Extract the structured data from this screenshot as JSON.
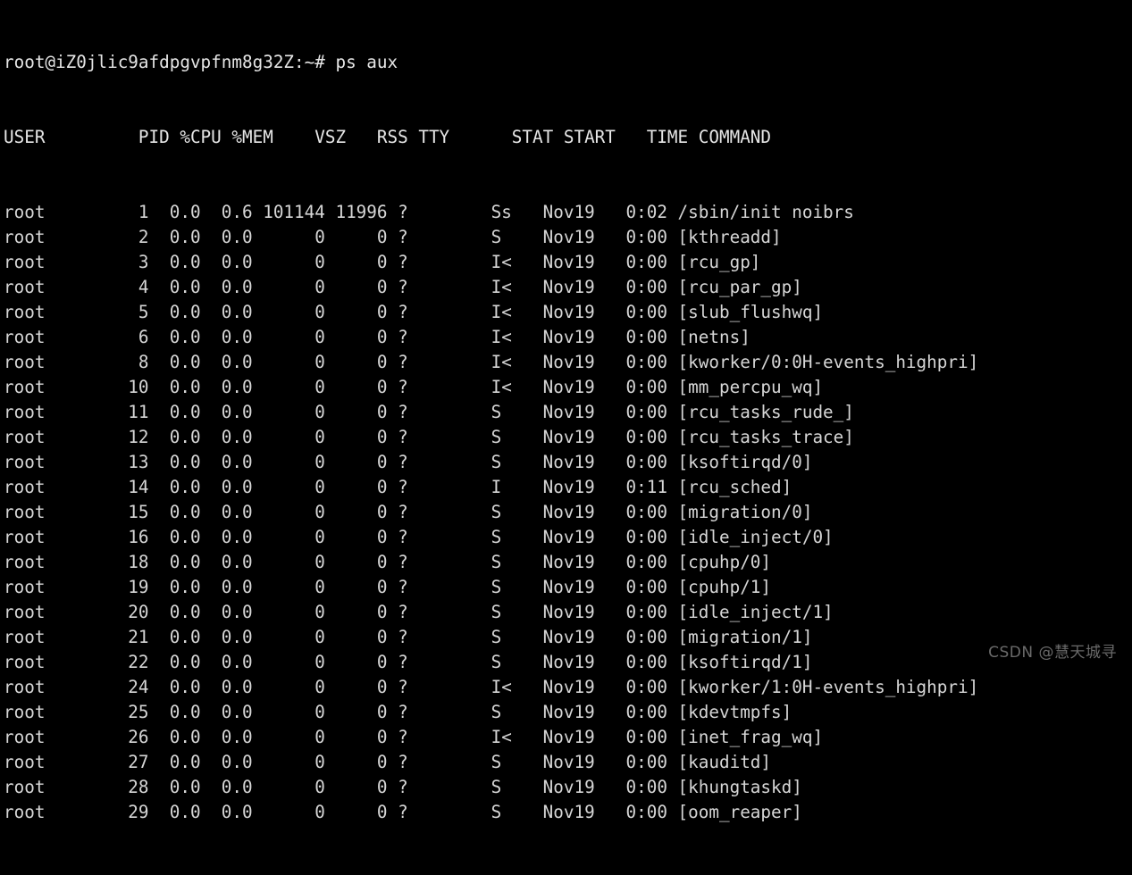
{
  "terminal": {
    "background_color": "#000000",
    "foreground_color": "#d8d8d8",
    "prompt_line": "root@iZ0jlic9afdpgvpfnm8g32Z:~# ps aux",
    "user": "root",
    "hostname": "iZ0jlic9afdpgvpfnm8g32Z",
    "cwd_symbol": "~",
    "prompt_symbol": "#",
    "command": "ps aux",
    "header": "USER         PID %CPU %MEM    VSZ   RSS TTY      STAT START   TIME COMMAND",
    "columns": [
      "USER",
      "PID",
      "%CPU",
      "%MEM",
      "VSZ",
      "RSS",
      "TTY",
      "STAT",
      "START",
      "TIME",
      "COMMAND"
    ],
    "rows": [
      {
        "USER": "root",
        "PID": "1",
        "CPU": "0.0",
        "MEM": "0.6",
        "VSZ": "101144",
        "RSS": "11996",
        "TTY": "?",
        "STAT": "Ss",
        "START": "Nov19",
        "TIME": "0:02",
        "COMMAND": "/sbin/init noibrs"
      },
      {
        "USER": "root",
        "PID": "2",
        "CPU": "0.0",
        "MEM": "0.0",
        "VSZ": "0",
        "RSS": "0",
        "TTY": "?",
        "STAT": "S",
        "START": "Nov19",
        "TIME": "0:00",
        "COMMAND": "[kthreadd]"
      },
      {
        "USER": "root",
        "PID": "3",
        "CPU": "0.0",
        "MEM": "0.0",
        "VSZ": "0",
        "RSS": "0",
        "TTY": "?",
        "STAT": "I<",
        "START": "Nov19",
        "TIME": "0:00",
        "COMMAND": "[rcu_gp]"
      },
      {
        "USER": "root",
        "PID": "4",
        "CPU": "0.0",
        "MEM": "0.0",
        "VSZ": "0",
        "RSS": "0",
        "TTY": "?",
        "STAT": "I<",
        "START": "Nov19",
        "TIME": "0:00",
        "COMMAND": "[rcu_par_gp]"
      },
      {
        "USER": "root",
        "PID": "5",
        "CPU": "0.0",
        "MEM": "0.0",
        "VSZ": "0",
        "RSS": "0",
        "TTY": "?",
        "STAT": "I<",
        "START": "Nov19",
        "TIME": "0:00",
        "COMMAND": "[slub_flushwq]"
      },
      {
        "USER": "root",
        "PID": "6",
        "CPU": "0.0",
        "MEM": "0.0",
        "VSZ": "0",
        "RSS": "0",
        "TTY": "?",
        "STAT": "I<",
        "START": "Nov19",
        "TIME": "0:00",
        "COMMAND": "[netns]"
      },
      {
        "USER": "root",
        "PID": "8",
        "CPU": "0.0",
        "MEM": "0.0",
        "VSZ": "0",
        "RSS": "0",
        "TTY": "?",
        "STAT": "I<",
        "START": "Nov19",
        "TIME": "0:00",
        "COMMAND": "[kworker/0:0H-events_highpri]"
      },
      {
        "USER": "root",
        "PID": "10",
        "CPU": "0.0",
        "MEM": "0.0",
        "VSZ": "0",
        "RSS": "0",
        "TTY": "?",
        "STAT": "I<",
        "START": "Nov19",
        "TIME": "0:00",
        "COMMAND": "[mm_percpu_wq]"
      },
      {
        "USER": "root",
        "PID": "11",
        "CPU": "0.0",
        "MEM": "0.0",
        "VSZ": "0",
        "RSS": "0",
        "TTY": "?",
        "STAT": "S",
        "START": "Nov19",
        "TIME": "0:00",
        "COMMAND": "[rcu_tasks_rude_]"
      },
      {
        "USER": "root",
        "PID": "12",
        "CPU": "0.0",
        "MEM": "0.0",
        "VSZ": "0",
        "RSS": "0",
        "TTY": "?",
        "STAT": "S",
        "START": "Nov19",
        "TIME": "0:00",
        "COMMAND": "[rcu_tasks_trace]"
      },
      {
        "USER": "root",
        "PID": "13",
        "CPU": "0.0",
        "MEM": "0.0",
        "VSZ": "0",
        "RSS": "0",
        "TTY": "?",
        "STAT": "S",
        "START": "Nov19",
        "TIME": "0:00",
        "COMMAND": "[ksoftirqd/0]"
      },
      {
        "USER": "root",
        "PID": "14",
        "CPU": "0.0",
        "MEM": "0.0",
        "VSZ": "0",
        "RSS": "0",
        "TTY": "?",
        "STAT": "I",
        "START": "Nov19",
        "TIME": "0:11",
        "COMMAND": "[rcu_sched]"
      },
      {
        "USER": "root",
        "PID": "15",
        "CPU": "0.0",
        "MEM": "0.0",
        "VSZ": "0",
        "RSS": "0",
        "TTY": "?",
        "STAT": "S",
        "START": "Nov19",
        "TIME": "0:00",
        "COMMAND": "[migration/0]"
      },
      {
        "USER": "root",
        "PID": "16",
        "CPU": "0.0",
        "MEM": "0.0",
        "VSZ": "0",
        "RSS": "0",
        "TTY": "?",
        "STAT": "S",
        "START": "Nov19",
        "TIME": "0:00",
        "COMMAND": "[idle_inject/0]"
      },
      {
        "USER": "root",
        "PID": "18",
        "CPU": "0.0",
        "MEM": "0.0",
        "VSZ": "0",
        "RSS": "0",
        "TTY": "?",
        "STAT": "S",
        "START": "Nov19",
        "TIME": "0:00",
        "COMMAND": "[cpuhp/0]"
      },
      {
        "USER": "root",
        "PID": "19",
        "CPU": "0.0",
        "MEM": "0.0",
        "VSZ": "0",
        "RSS": "0",
        "TTY": "?",
        "STAT": "S",
        "START": "Nov19",
        "TIME": "0:00",
        "COMMAND": "[cpuhp/1]"
      },
      {
        "USER": "root",
        "PID": "20",
        "CPU": "0.0",
        "MEM": "0.0",
        "VSZ": "0",
        "RSS": "0",
        "TTY": "?",
        "STAT": "S",
        "START": "Nov19",
        "TIME": "0:00",
        "COMMAND": "[idle_inject/1]"
      },
      {
        "USER": "root",
        "PID": "21",
        "CPU": "0.0",
        "MEM": "0.0",
        "VSZ": "0",
        "RSS": "0",
        "TTY": "?",
        "STAT": "S",
        "START": "Nov19",
        "TIME": "0:00",
        "COMMAND": "[migration/1]"
      },
      {
        "USER": "root",
        "PID": "22",
        "CPU": "0.0",
        "MEM": "0.0",
        "VSZ": "0",
        "RSS": "0",
        "TTY": "?",
        "STAT": "S",
        "START": "Nov19",
        "TIME": "0:00",
        "COMMAND": "[ksoftirqd/1]"
      },
      {
        "USER": "root",
        "PID": "24",
        "CPU": "0.0",
        "MEM": "0.0",
        "VSZ": "0",
        "RSS": "0",
        "TTY": "?",
        "STAT": "I<",
        "START": "Nov19",
        "TIME": "0:00",
        "COMMAND": "[kworker/1:0H-events_highpri]"
      },
      {
        "USER": "root",
        "PID": "25",
        "CPU": "0.0",
        "MEM": "0.0",
        "VSZ": "0",
        "RSS": "0",
        "TTY": "?",
        "STAT": "S",
        "START": "Nov19",
        "TIME": "0:00",
        "COMMAND": "[kdevtmpfs]"
      },
      {
        "USER": "root",
        "PID": "26",
        "CPU": "0.0",
        "MEM": "0.0",
        "VSZ": "0",
        "RSS": "0",
        "TTY": "?",
        "STAT": "I<",
        "START": "Nov19",
        "TIME": "0:00",
        "COMMAND": "[inet_frag_wq]"
      },
      {
        "USER": "root",
        "PID": "27",
        "CPU": "0.0",
        "MEM": "0.0",
        "VSZ": "0",
        "RSS": "0",
        "TTY": "?",
        "STAT": "S",
        "START": "Nov19",
        "TIME": "0:00",
        "COMMAND": "[kauditd]"
      },
      {
        "USER": "root",
        "PID": "28",
        "CPU": "0.0",
        "MEM": "0.0",
        "VSZ": "0",
        "RSS": "0",
        "TTY": "?",
        "STAT": "S",
        "START": "Nov19",
        "TIME": "0:00",
        "COMMAND": "[khungtaskd]"
      },
      {
        "USER": "root",
        "PID": "29",
        "CPU": "0.0",
        "MEM": "0.0",
        "VSZ": "0",
        "RSS": "0",
        "TTY": "?",
        "STAT": "S",
        "START": "Nov19",
        "TIME": "0:00",
        "COMMAND": "[oom_reaper]"
      }
    ]
  },
  "watermark": {
    "text": "CSDN @慧天城寻",
    "color": "#6a6a6a"
  }
}
